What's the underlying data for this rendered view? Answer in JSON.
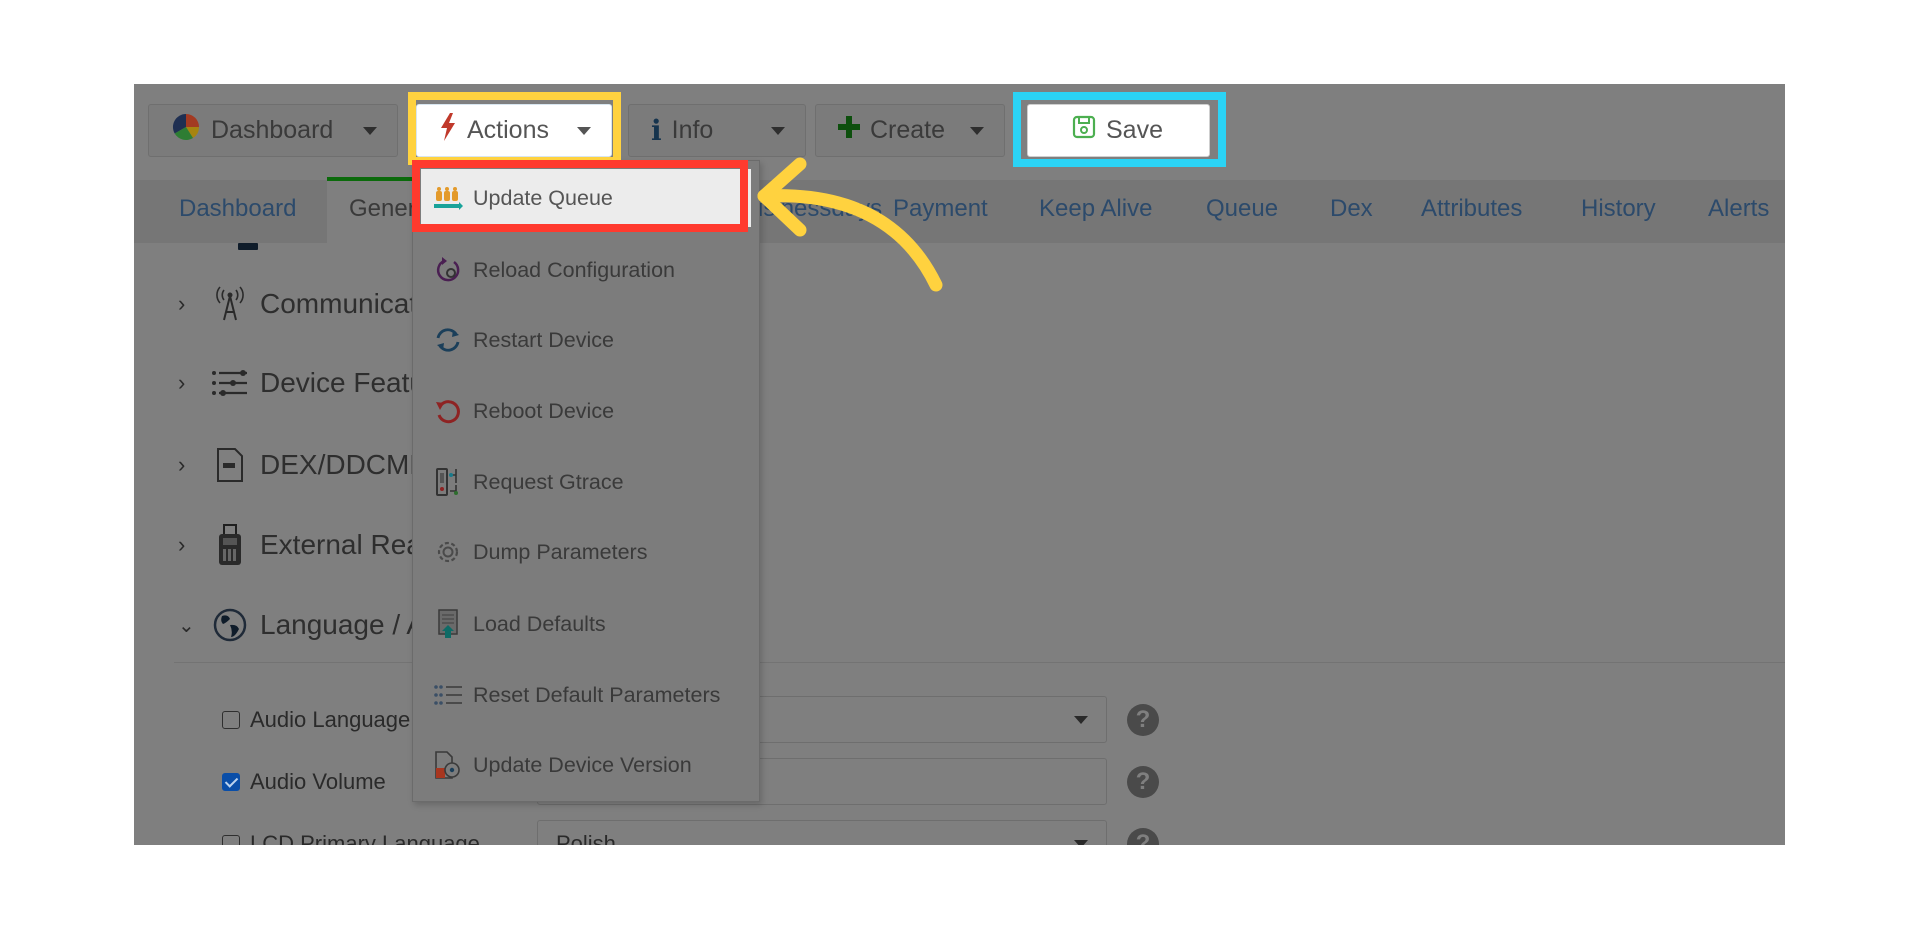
{
  "toolbar": {
    "dashboard_label": "Dashboard",
    "actions_label": "Actions",
    "info_label": "Info",
    "create_label": "Create",
    "save_label": "Save"
  },
  "tabs": [
    {
      "label": "Dashboard"
    },
    {
      "label": "General"
    },
    {
      "label": "Businessdays"
    },
    {
      "label": "Payment"
    },
    {
      "label": "Keep Alive"
    },
    {
      "label": "Queue"
    },
    {
      "label": "Dex"
    },
    {
      "label": "Attributes"
    },
    {
      "label": "History"
    },
    {
      "label": "Alerts"
    }
  ],
  "active_tab": "General",
  "accordion": [
    {
      "label": "Communication",
      "icon": "antenna-icon",
      "expanded": false
    },
    {
      "label": "Device Features",
      "icon": "sliders-icon",
      "expanded": false
    },
    {
      "label": "DEX/DDCMP",
      "icon": "dex-file-icon",
      "expanded": false
    },
    {
      "label": "External Readers",
      "icon": "card-reader-icon",
      "expanded": false
    },
    {
      "label": "Language / Audio",
      "icon": "globe-icon",
      "expanded": true
    }
  ],
  "form": {
    "rows": [
      {
        "label": "Audio Language",
        "checked": false,
        "type": "select",
        "value": ""
      },
      {
        "label": "Audio Volume",
        "checked": true,
        "type": "text",
        "value": ""
      },
      {
        "label": "LCD Primary Language",
        "checked": false,
        "type": "select",
        "value": "Polish"
      }
    ],
    "help_symbol": "?"
  },
  "actions_menu": {
    "items": [
      {
        "label": "Update Queue",
        "icon": "queue-icon",
        "highlighted": true
      },
      {
        "label": "Reload Configuration",
        "icon": "reload-config-icon"
      },
      {
        "label": "Restart Device",
        "icon": "restart-icon"
      },
      {
        "label": "Reboot Device",
        "icon": "reboot-icon"
      },
      {
        "label": "Request Gtrace",
        "icon": "gtrace-icon"
      },
      {
        "label": "Dump Parameters",
        "icon": "gear-icon"
      },
      {
        "label": "Load Defaults",
        "icon": "load-defaults-icon"
      },
      {
        "label": "Reset Default Parameters",
        "icon": "list-icon"
      },
      {
        "label": "Update Device Version",
        "icon": "update-version-icon"
      }
    ]
  },
  "annotations": {
    "actions_highlight_color": "#ffd23f",
    "save_highlight_color": "#2bd3f5",
    "menu_item_highlight_color": "#ff3a2e",
    "arrow_color": "#ffd23f"
  },
  "colors": {
    "overlay_gray": "#7f7f7f",
    "tab_link": "#2c4a6b",
    "active_tab_underline": "#0b6a0b",
    "checkbox_checked": "#0a4ea8"
  }
}
